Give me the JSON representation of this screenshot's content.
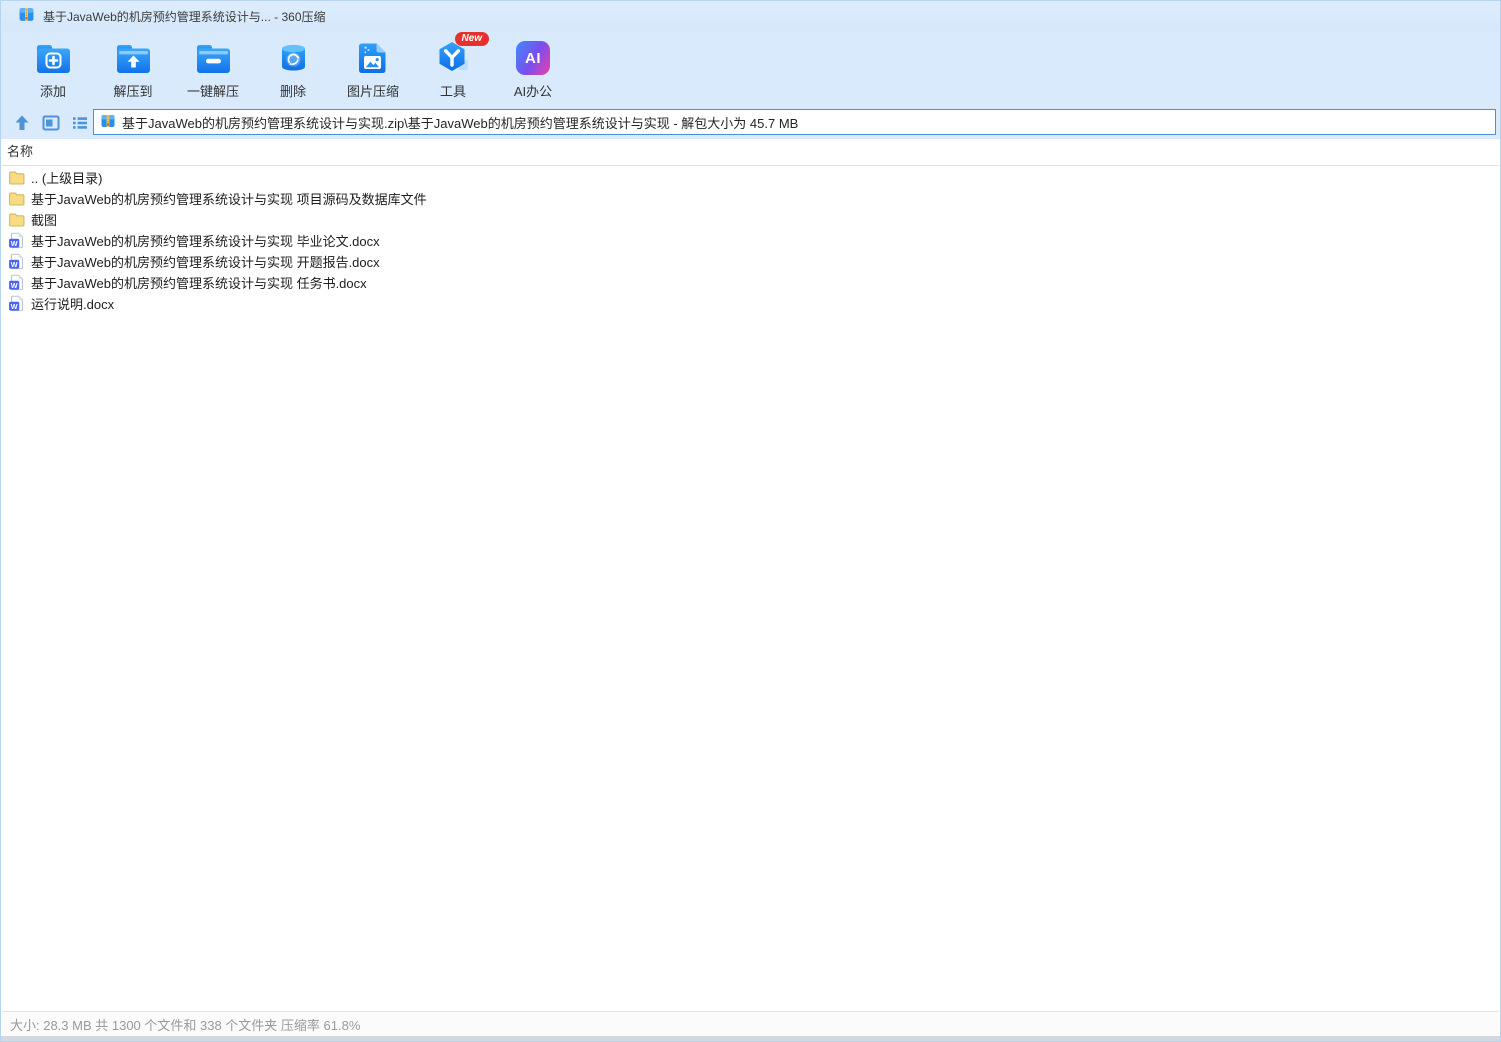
{
  "window": {
    "title": "基于JavaWeb的机房预约管理系统设计与... - 360压缩",
    "app_name": "360压缩",
    "icon": "archive-file-icon"
  },
  "toolbar": {
    "items": [
      {
        "label": "添加",
        "icon": "add-folder-icon"
      },
      {
        "label": "解压到",
        "icon": "extract-to-folder-icon"
      },
      {
        "label": "一键解压",
        "icon": "one-click-extract-folder-icon"
      },
      {
        "label": "删除",
        "icon": "delete-trash-icon"
      },
      {
        "label": "图片压缩",
        "icon": "image-compress-icon"
      },
      {
        "label": "工具",
        "icon": "tools-cube-icon",
        "badge": "New"
      },
      {
        "label": "AI办公",
        "icon": "ai-office-icon",
        "icon_text": "AI"
      }
    ]
  },
  "navigation": {
    "icons": [
      "up-arrow-icon",
      "view-mode-icon",
      "list-view-icon"
    ]
  },
  "address_bar": {
    "path": "基于JavaWeb的机房预约管理系统设计与实现.zip\\基于JavaWeb的机房预约管理系统设计与实现 - 解包大小为 45.7 MB",
    "unpacked_size": "45.7 MB"
  },
  "file_list": {
    "column_header": "名称",
    "items": [
      {
        "name": ".. (上级目录)",
        "type": "folder"
      },
      {
        "name": "基于JavaWeb的机房预约管理系统设计与实现 项目源码及数据库文件",
        "type": "folder"
      },
      {
        "name": "截图",
        "type": "folder"
      },
      {
        "name": "基于JavaWeb的机房预约管理系统设计与实现 毕业论文.docx",
        "type": "docx"
      },
      {
        "name": "基于JavaWeb的机房预约管理系统设计与实现 开题报告.docx",
        "type": "docx"
      },
      {
        "name": "基于JavaWeb的机房预约管理系统设计与实现 任务书.docx",
        "type": "docx"
      },
      {
        "name": "运行说明.docx",
        "type": "docx"
      }
    ]
  },
  "status_bar": {
    "text": "大小: 28.3 MB 共 1300 个文件和 338 个文件夹 压缩率 61.8%"
  },
  "colors": {
    "titlebar_bg": "#d8eafc",
    "accent_blue": "#2490f5",
    "nav_icon_blue": "#4f93d9",
    "badge_red": "#e8312f",
    "folder_yellow": "#f7dc85",
    "word_blue": "#4a66f0",
    "status_text": "#9a9a9a"
  }
}
